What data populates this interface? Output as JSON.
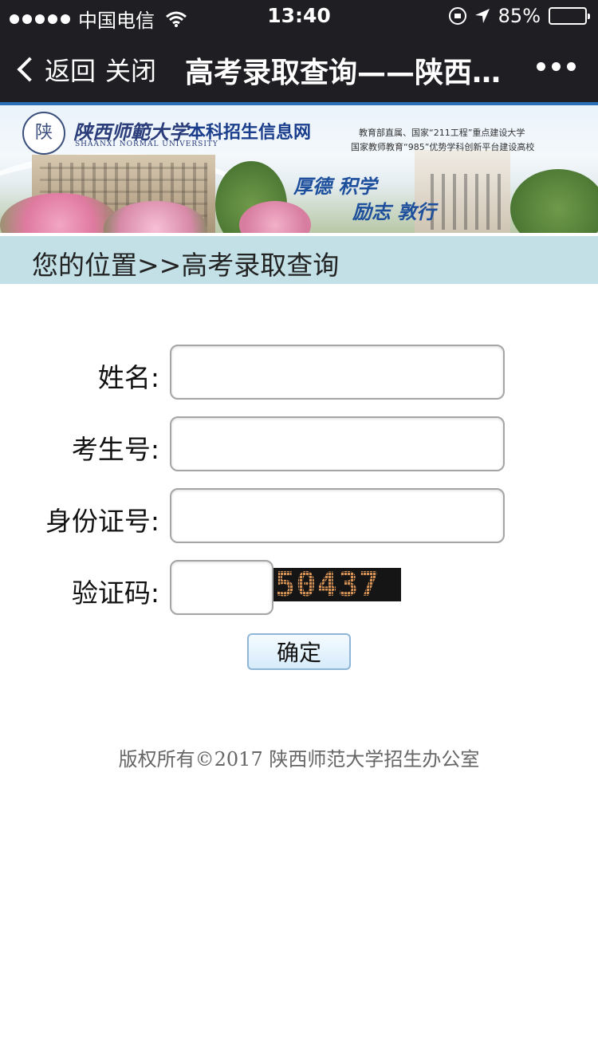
{
  "status_bar": {
    "carrier": "中国电信",
    "time": "13:40",
    "battery": "85%",
    "battery_level": 0.85
  },
  "nav": {
    "back_label": "返回",
    "close_label": "关闭",
    "title": "高考录取查询——陕西…"
  },
  "banner": {
    "seal_char": "陕",
    "university_cn": "陕西师範大学",
    "university_en": "SHAANXI NORMAL UNIVERSITY",
    "site_name": "本科招生信息网",
    "tagline1": "教育部直属、国家“211工程”重点建设大学",
    "tagline2": "国家教师教育“985”优势学科创新平台建设高校",
    "motto1": "厚德 积学",
    "motto2": "励志 敦行"
  },
  "breadcrumb": "您的位置>>高考录取查询",
  "form": {
    "name_label": "姓名:",
    "name_value": "",
    "exam_label": "考生号:",
    "exam_value": "",
    "id_label": "身份证号:",
    "id_value": "",
    "captcha_label": "验证码:",
    "captcha_value": "",
    "captcha_text": "50437",
    "submit_label": "确定"
  },
  "footer": "版权所有©2017 陕西师范大学招生办公室",
  "colors": {
    "bar_bg": "#1f1f23",
    "breadcrumb_bg": "#c2e0e6",
    "captcha_digit": "#d79356"
  }
}
